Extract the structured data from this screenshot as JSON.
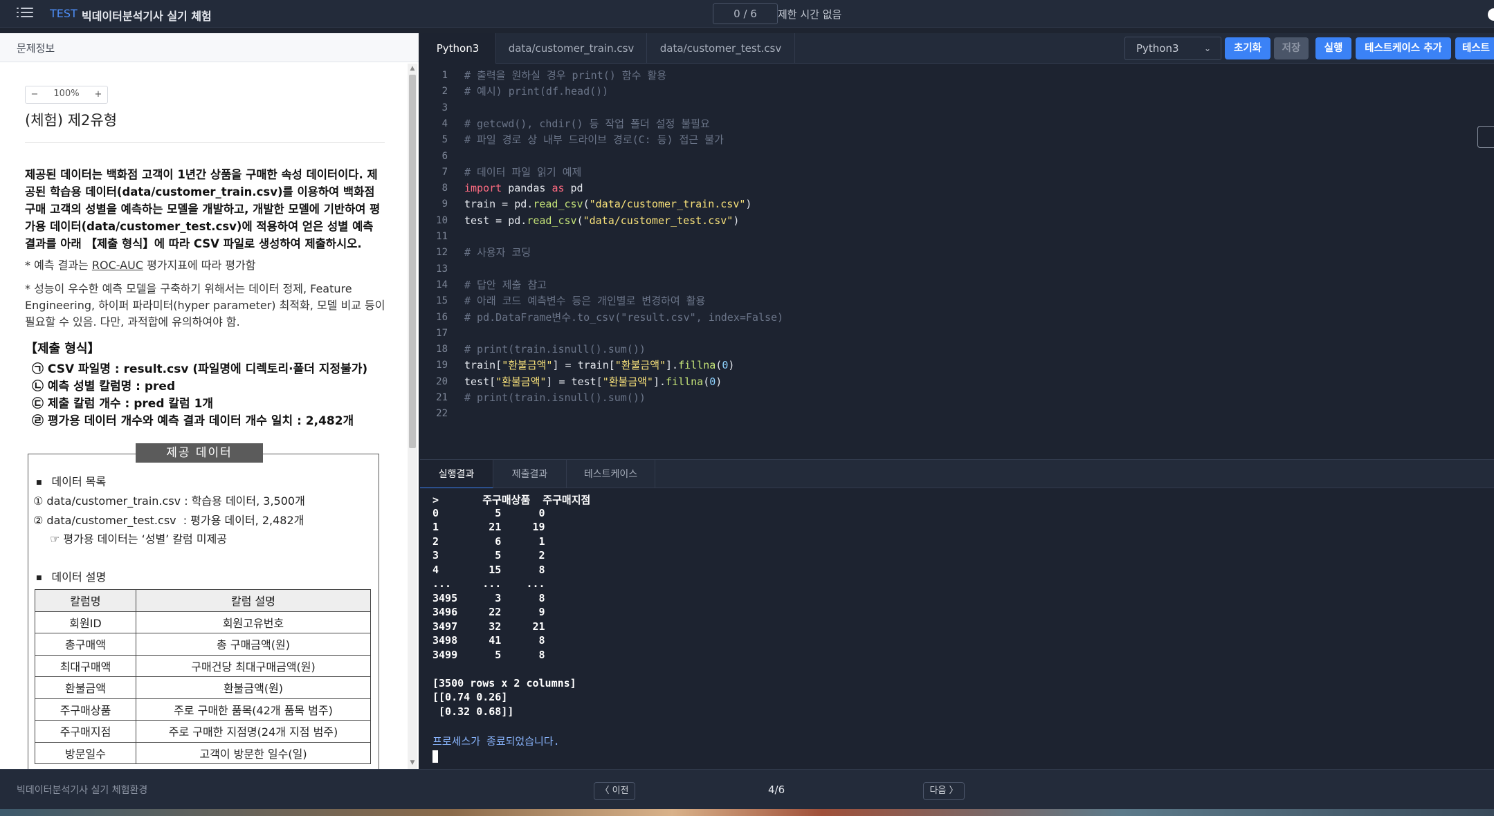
{
  "topbar": {
    "tag": "TEST",
    "title": "빅데이터분석기사 실기 체험",
    "progress": "0 / 6",
    "time_limit": "제한 시간 없음"
  },
  "left": {
    "header": "문제정보",
    "zoom": "100%",
    "zoom_out_icon": "−",
    "zoom_in_icon": "+",
    "problem_title": "(체험) 제2유형",
    "description": "제공된 데이터는 백화점 고객이 1년간 상품을 구매한 속성 데이터이다. 제공된 학습용 데이터(data/customer_train.csv)를 이용하여 백화점 구매 고객의 성별을 예측하는 모델을 개발하고, 개발한 모델에 기반하여 평가용 데이터(data/customer_test.csv)에 적용하여 얻은 성별 예측 결과를 아래 【제출 형식】에 따라 CSV 파일로 생성하여 제출하시오.",
    "note1_prefix": "* 예측 결과는 ",
    "note1_metric": "ROC-AUC",
    "note1_suffix": " 평가지표에 따라 평가함",
    "note2": "* 성능이 우수한 예측 모델을 구축하기 위해서는 데이터 정제, Feature Engineering, 하이퍼 파라미터(hyper parameter) 최적화, 모델 비교 등이 필요할 수 있음. 다만, 과적합에 유의하여야 함.",
    "submit_title": "【제출 형식】",
    "submit_items": [
      "㉠ CSV 파일명 : result.csv (파일명에 디렉토리·폴더 지정불가)",
      "㉡ 예측 성별 칼럼명 : pred",
      "㉢ 제출 칼럼 개수 : pred 칼럼 1개",
      "㉣ 평가용 데이터 개수와 예측 결과 데이터 개수 일치 : 2,482개"
    ],
    "data_box_title": "제공 데이터",
    "data_list_title": "데이터 목록",
    "data_list": [
      "① data/customer_train.csv : 학습용 데이터, 3,500개",
      "② data/customer_test.csv  : 평가용 데이터, 2,482개",
      "☞ 평가용 데이터는 ‘성별’ 칼럼 미제공"
    ],
    "data_desc_title": "데이터 설명",
    "table_headers": [
      "칼럼명",
      "칼럼 설명"
    ],
    "table_rows": [
      [
        "회원ID",
        "회원고유번호"
      ],
      [
        "총구매액",
        "총 구매금액(원)"
      ],
      [
        "최대구매액",
        "구매건당 최대구매금액(원)"
      ],
      [
        "환불금액",
        "환불금액(원)"
      ],
      [
        "주구매상품",
        "주로 구매한 품목(42개 품목 범주)"
      ],
      [
        "주구매지점",
        "주로 구매한 지점명(24개 지점 범주)"
      ],
      [
        "방문일수",
        "고객이 방문한 일수(일)"
      ]
    ]
  },
  "editor_tabs": [
    "Python3",
    "data/customer_train.csv",
    "data/customer_test.csv"
  ],
  "language_select": "Python3",
  "buttons": {
    "reset": "초기화",
    "save": "저장",
    "run": "실행",
    "add_testcase": "테스트케이스 추가",
    "test": "테스트"
  },
  "code_lines": [
    "# 출력을 원하실 경우 print() 함수 활용",
    "# 예시) print(df.head())",
    "",
    "# getcwd(), chdir() 등 작업 폴더 설정 불필요",
    "# 파일 경로 상 내부 드라이브 경로(C: 등) 접근 불가",
    "",
    "# 데이터 파일 읽기 예제",
    "import pandas as pd",
    "train = pd.read_csv(\"data/customer_train.csv\")",
    "test = pd.read_csv(\"data/customer_test.csv\")",
    "",
    "# 사용자 코딩",
    "",
    "# 답안 제출 참고",
    "# 아래 코드 예측변수 등은 개인별로 변경하여 활용",
    "# pd.DataFrame변수.to_csv(\"result.csv\", index=False)",
    "",
    "# print(train.isnull().sum())",
    "train[\"환불금액\"] = train[\"환불금액\"].fillna(0)",
    "test[\"환불금액\"] = test[\"환불금액\"].fillna(0)",
    "# print(train.isnull().sum())",
    ""
  ],
  "output_tabs": [
    "실행결과",
    "제출결과",
    "테스트케이스"
  ],
  "console_lines": [
    ">       주구매상품  주구매지점",
    "0         5      0",
    "1        21     19",
    "2         6      1",
    "3         5      2",
    "4        15      8",
    "...     ...    ...",
    "3495      3      8",
    "3496     22      9",
    "3497     32     21",
    "3498     41      8",
    "3499      5      8",
    "",
    "[3500 rows x 2 columns]",
    "[[0.74 0.26]",
    " [0.32 0.68]]",
    "",
    "프로세스가 종료되었습니다."
  ],
  "footer": {
    "label": "빅데이터분석기사 실기 체험환경",
    "prev": "〈 이전",
    "page": "4/6",
    "next": "다음 〉"
  }
}
